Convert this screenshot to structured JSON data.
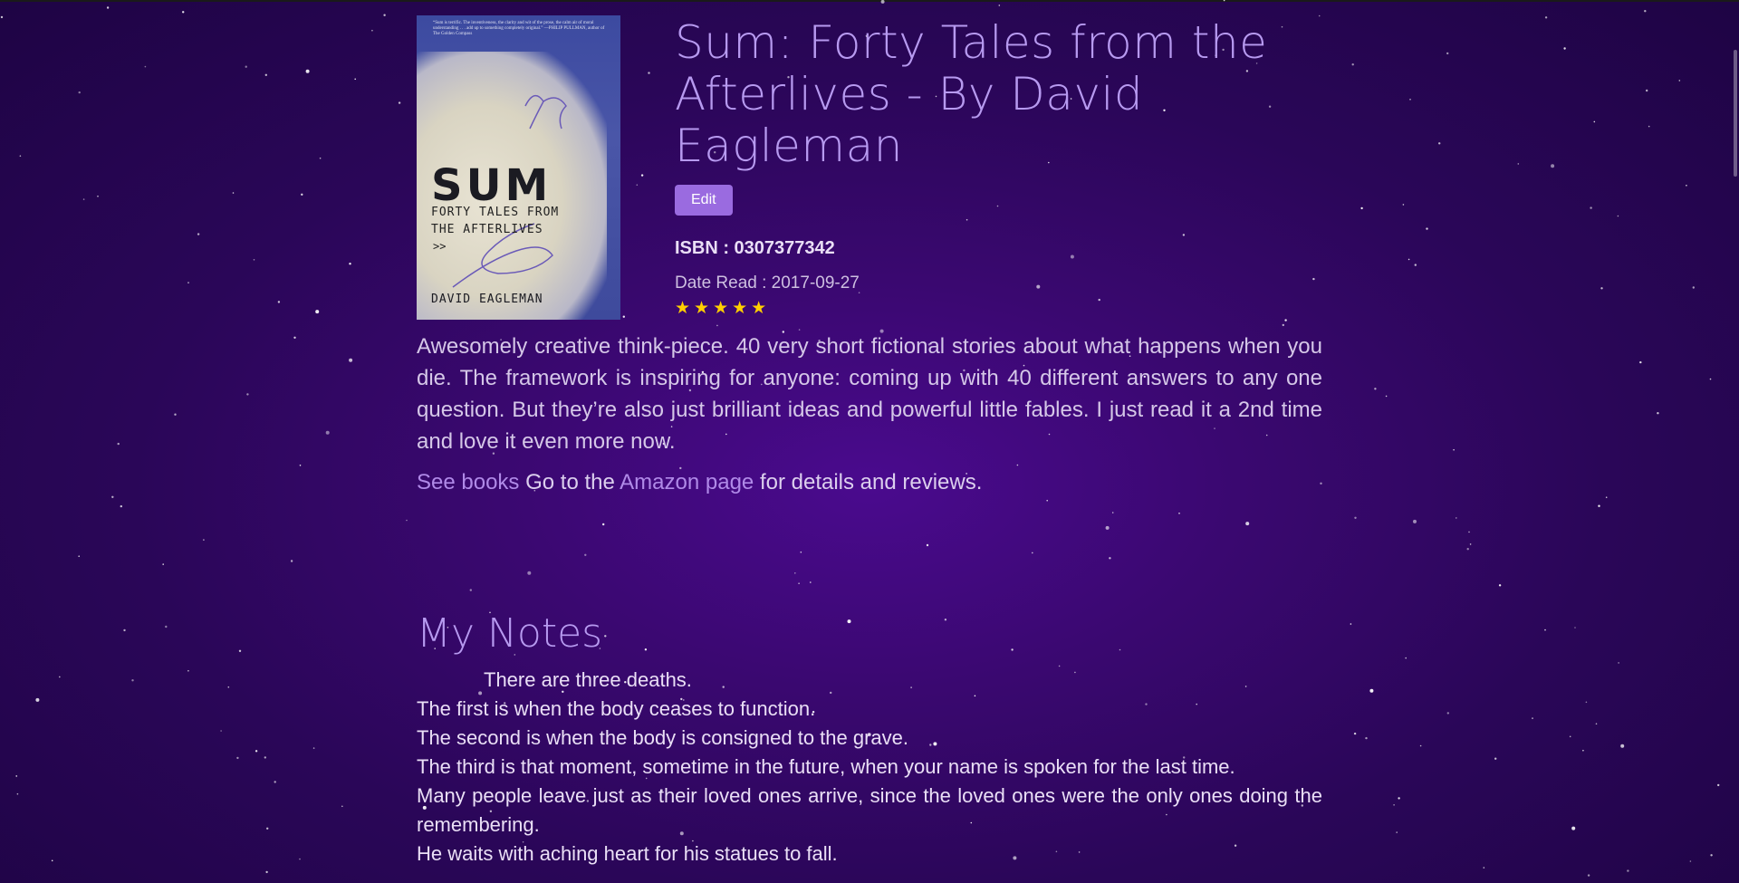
{
  "book": {
    "title": "Sum: Forty Tales from the Afterlives - By David Eagleman",
    "edit_label": "Edit",
    "isbn": "ISBN : 0307377342",
    "date_read": "Date Read : 2017-09-27",
    "rating": 5,
    "rating_display": "★★★★★",
    "review": "Awesomely creative think-piece. 40 very short fictional stories about what happens when you die. The framework is inspiring for anyone: coming up with 40 different answers to any one question. But they’re also just brilliant ideas and powerful little fables. I just read it a 2nd time and love it even more now."
  },
  "cover": {
    "blurb": "“Sum is terrific. The inventiveness, the clarity and wit of the prose, the calm air of moral understanding . . . add up to something completely original.” —PHILIP PULLMAN, author of The Golden Compass",
    "title": "SUM",
    "subtitle": "FORTY TALES FROM THE AFTERLIVES",
    "arrows": ">>",
    "author": "DAVID EAGLEMAN"
  },
  "links": {
    "see_books": "See books",
    "go_to": " Go to the ",
    "amazon": "Amazon page",
    "suffix": " for details and reviews."
  },
  "notes": {
    "heading": "My Notes",
    "lines": [
      "There are three deaths.",
      "The first is when the body ceases to function.",
      "The second is when the body is consigned to the grave.",
      "The third is that moment, sometime in the future, when your name is spoken for the last time.",
      "Many people leave just as their loved ones arrive, since the loved ones were the only ones doing the remembering.",
      "He waits with aching heart for his statues to fall."
    ]
  },
  "colors": {
    "accent": "#b79af0",
    "button": "#9a6be0",
    "star": "#ffcf00",
    "background": "#2a0658"
  }
}
